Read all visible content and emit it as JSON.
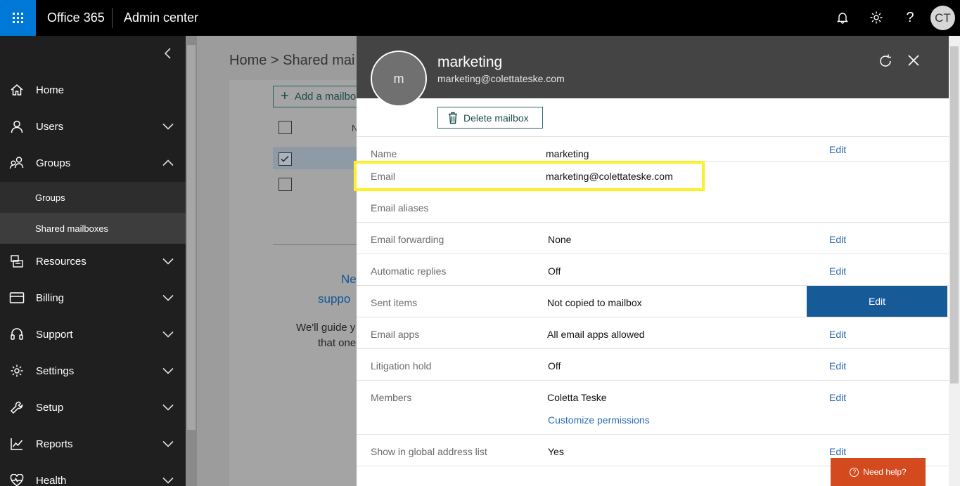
{
  "topbar": {
    "brand": "Office 365",
    "app_name": "Admin center",
    "user_initials": "CT",
    "icons": [
      "waffle-icon",
      "bell-icon",
      "gear-icon",
      "help-icon"
    ]
  },
  "sidebar": {
    "items": [
      {
        "label": "Home",
        "icon": "home-icon"
      },
      {
        "label": "Users",
        "icon": "user-icon"
      },
      {
        "label": "Groups",
        "icon": "groups-icon"
      },
      {
        "label": "Resources",
        "icon": "resources-icon"
      },
      {
        "label": "Billing",
        "icon": "billing-icon"
      },
      {
        "label": "Support",
        "icon": "headset-icon"
      },
      {
        "label": "Settings",
        "icon": "gear-icon"
      },
      {
        "label": "Setup",
        "icon": "wrench-icon"
      },
      {
        "label": "Reports",
        "icon": "chart-icon"
      },
      {
        "label": "Health",
        "icon": "heart-icon"
      }
    ],
    "subitems": [
      {
        "label": "Groups"
      },
      {
        "label": "Shared mailboxes",
        "active": true
      }
    ]
  },
  "background": {
    "breadcrumb": "Home > Shared mai",
    "add_button": "Add a mailbo",
    "column_fragment": "N",
    "promo_line1": "Ne",
    "promo_line2": "suppo",
    "promo_line3": "We'll guide y",
    "promo_line4": "that one"
  },
  "panel": {
    "avatar_letter": "m",
    "name": "marketing",
    "email": "marketing@colettateske.com",
    "delete_button": "Delete mailbox",
    "rows": [
      {
        "key": "Name",
        "value": "marketing",
        "edit": "Edit"
      },
      {
        "key": "Email",
        "value": "marketing@colettateske.com"
      },
      {
        "key": "Email aliases"
      },
      {
        "key": "Email forwarding",
        "value": "None",
        "edit": "Edit"
      },
      {
        "key": "Automatic replies",
        "value": "Off",
        "edit": "Edit"
      },
      {
        "key": "Sent items",
        "value": "Not copied to mailbox",
        "edit": "Edit"
      },
      {
        "key": "Email apps",
        "value": "All email apps allowed",
        "edit": "Edit"
      },
      {
        "key": "Litigation hold",
        "value": "Off",
        "edit": "Edit"
      },
      {
        "key": "Members",
        "value": "Coletta Teske",
        "link": "Customize permissions",
        "edit": "Edit"
      },
      {
        "key": "Show in global address list",
        "value": "Yes",
        "edit": "Edit"
      }
    ]
  },
  "help_button": "Need help?",
  "colors": {
    "accent": "#0078d7",
    "highlight": "#ffef2b",
    "edit_link": "#2b6cb0",
    "active_edit": "#165b97",
    "help": "#d44a1f"
  }
}
